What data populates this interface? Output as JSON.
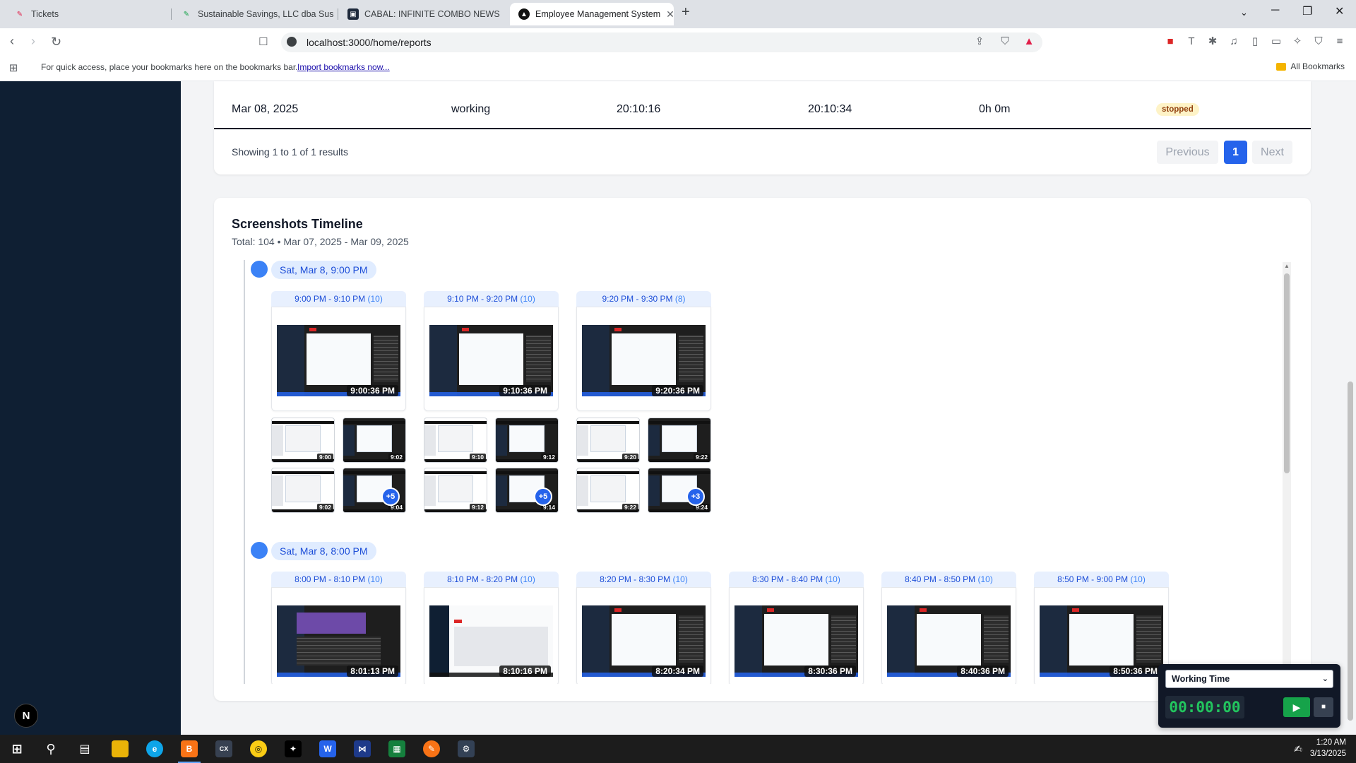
{
  "browser": {
    "tabs": [
      {
        "title": "Tickets",
        "active": false
      },
      {
        "title": "Sustainable Savings, LLC dba Sustai",
        "active": false
      },
      {
        "title": "CABAL: INFINITE COMBO NEWS",
        "active": false
      },
      {
        "title": "Employee Management System",
        "active": true
      }
    ],
    "url": "localhost:3000/home/reports",
    "bookmarks_hint": "For quick access, place your bookmarks here on the bookmarks bar.",
    "import_link": "Import bookmarks now...",
    "all_bookmarks": "All Bookmarks"
  },
  "report_table": {
    "row": {
      "date": "Mar 08, 2025",
      "type": "working",
      "start": "20:10:16",
      "end": "20:10:34",
      "duration": "0h 0m",
      "status": "stopped"
    },
    "showing_text": "Showing 1 to 1 of 1 results",
    "pagination": {
      "previous": "Previous",
      "current": "1",
      "next": "Next"
    }
  },
  "timeline": {
    "title": "Screenshots Timeline",
    "subtitle": "Total: 104 • Mar 07, 2025 - Mar 09, 2025",
    "hours": [
      {
        "label": "Sat, Mar 8, 9:00 PM",
        "slots": [
          {
            "range": "9:00 PM - 9:10 PM",
            "count": "(10)",
            "main_time": "9:00:36 PM",
            "thumb_times": [
              "9:00",
              "9:02",
              "9:02",
              "9:04"
            ],
            "more": "+5"
          },
          {
            "range": "9:10 PM - 9:20 PM",
            "count": "(10)",
            "main_time": "9:10:36 PM",
            "thumb_times": [
              "9:10",
              "9:12",
              "9:12",
              "9:14"
            ],
            "more": "+5"
          },
          {
            "range": "9:20 PM - 9:30 PM",
            "count": "(8)",
            "main_time": "9:20:36 PM",
            "thumb_times": [
              "9:20",
              "9:22",
              "9:22",
              "9:24"
            ],
            "more": "+3"
          }
        ]
      },
      {
        "label": "Sat, Mar 8, 8:00 PM",
        "slots": [
          {
            "range": "8:00 PM - 8:10 PM",
            "count": "(10)",
            "main_time": "8:01:13 PM"
          },
          {
            "range": "8:10 PM - 8:20 PM",
            "count": "(10)",
            "main_time": "8:10:16 PM"
          },
          {
            "range": "8:20 PM - 8:30 PM",
            "count": "(10)",
            "main_time": "8:20:34 PM"
          },
          {
            "range": "8:30 PM - 8:40 PM",
            "count": "(10)",
            "main_time": "8:30:36 PM"
          },
          {
            "range": "8:40 PM - 8:50 PM",
            "count": "(10)",
            "main_time": "8:40:36 PM"
          },
          {
            "range": "8:50 PM - 9:00 PM",
            "count": "(10)",
            "main_time": "8:50:36 PM"
          }
        ]
      }
    ]
  },
  "timer": {
    "mode": "Working Time",
    "clock": "00:00:00"
  },
  "taskbar": {
    "time": "1:20 AM",
    "date": "3/13/2025"
  },
  "colors": {
    "accent": "#2563eb",
    "sidebar": "#0f1f33",
    "timer_green": "#22c55e",
    "status_stopped_bg": "#fef3c7"
  }
}
